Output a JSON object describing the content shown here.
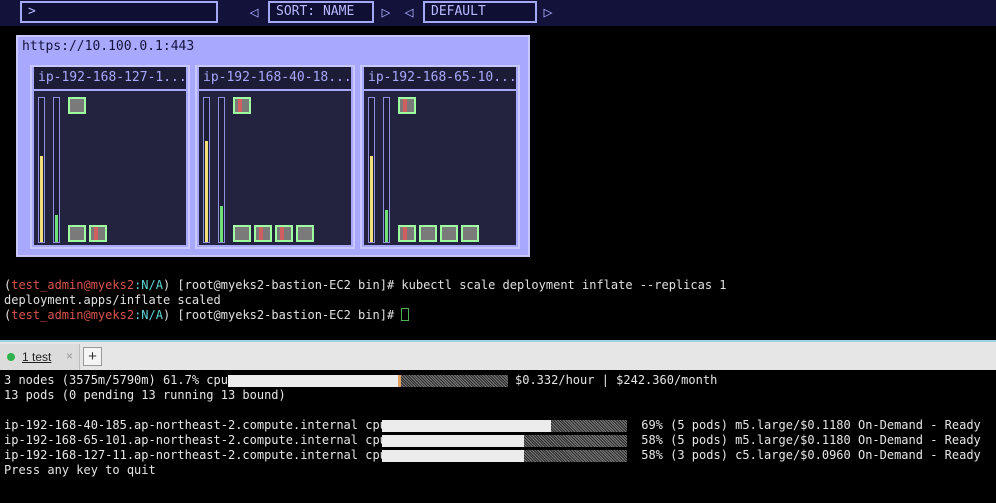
{
  "viewer": {
    "filter_value": ">",
    "sort_label": "SORT: NAME",
    "theme_label": "DEFAULT",
    "cluster_url": "https://10.100.0.1:443",
    "nodes": [
      {
        "title": "ip-192-168-127-1...",
        "cpu_pct": 0.6,
        "mem_pct": 0.19,
        "top_pods": [
          {
            "red": false
          }
        ],
        "bottom_pods": [
          {
            "red": false
          },
          {
            "red": true
          }
        ]
      },
      {
        "title": "ip-192-168-40-18...",
        "cpu_pct": 0.7,
        "mem_pct": 0.25,
        "top_pods": [
          {
            "red": true
          }
        ],
        "bottom_pods": [
          {
            "red": false
          },
          {
            "red": true
          },
          {
            "red": true
          },
          {
            "red": false
          }
        ]
      },
      {
        "title": "ip-192-168-65-10...",
        "cpu_pct": 0.6,
        "mem_pct": 0.22,
        "top_pods": [
          {
            "red": true
          }
        ],
        "bottom_pods": [
          {
            "red": true
          },
          {
            "red": false
          },
          {
            "red": false
          },
          {
            "red": false
          }
        ]
      }
    ]
  },
  "terminal": {
    "prompt_open": "(",
    "prompt_user": "test_admin@myeks2",
    "prompt_ns": ":N/A",
    "prompt_close": ")",
    "prompt_host": " [root@myeks2-bastion-EC2 bin]# ",
    "command": "kubectl scale deployment inflate --replicas 1",
    "output": "deployment.apps/inflate scaled"
  },
  "tabbar": {
    "tab_label": "1 test",
    "close_glyph": "×",
    "add_glyph": "+"
  },
  "node_viewer": {
    "summary_prefix": "3 nodes (3575m/5790m) 61.7% cpu",
    "summary_pct": 0.617,
    "summary_cost": "$0.332/hour | $242.360/month",
    "pods_line": "13 pods (0 pending 13 running 13 bound)",
    "rows": [
      {
        "name": "ip-192-168-40-185.ap-northeast-2.compute.internal cpu",
        "pct": 0.69,
        "detail": " 69% (5 pods) m5.large/$0.1180 On-Demand - Ready"
      },
      {
        "name": "ip-192-168-65-101.ap-northeast-2.compute.internal cpu",
        "pct": 0.58,
        "detail": " 58% (5 pods) m5.large/$0.1180 On-Demand - Ready"
      },
      {
        "name": "ip-192-168-127-11.ap-northeast-2.compute.internal cpu",
        "pct": 0.58,
        "detail": " 58% (3 pods) c5.large/$0.0960 On-Demand - Ready"
      }
    ],
    "quit_hint": "Press any key to quit"
  },
  "colors": {
    "cpu_bar": "#f2e07a",
    "mem_bar": "#6ee07a",
    "pod_border": "#9dff9d",
    "prompt_user": "#d9534f",
    "prompt_ns": "#5fd7d7"
  }
}
